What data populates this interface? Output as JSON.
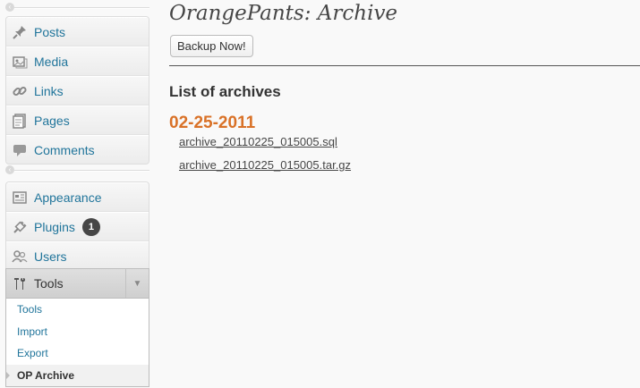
{
  "sidebar": {
    "group1": [
      {
        "label": "Posts",
        "icon": "pushpin-icon"
      },
      {
        "label": "Media",
        "icon": "media-icon"
      },
      {
        "label": "Links",
        "icon": "chain-link-icon"
      },
      {
        "label": "Pages",
        "icon": "pages-icon"
      },
      {
        "label": "Comments",
        "icon": "speech-bubble-icon"
      }
    ],
    "group2": [
      {
        "label": "Appearance",
        "icon": "appearance-icon"
      },
      {
        "label": "Plugins",
        "icon": "plug-icon",
        "badge": "1"
      },
      {
        "label": "Users",
        "icon": "users-icon"
      }
    ],
    "tools": {
      "label": "Tools",
      "icon": "tools-icon",
      "submenu": [
        "Tools",
        "Import",
        "Export",
        "OP Archive"
      ],
      "current": "OP Archive"
    }
  },
  "main": {
    "title": "OrangePants: Archive",
    "backup_button": "Backup Now!",
    "archives_heading": "List of archives",
    "archive_date": "02-25-2011",
    "files": [
      "archive_20110225_015005.sql",
      "archive_20110225_015005.tar.gz"
    ]
  },
  "colors": {
    "link": "#21759b",
    "date_accent": "#d97127",
    "badge": "#464646"
  }
}
